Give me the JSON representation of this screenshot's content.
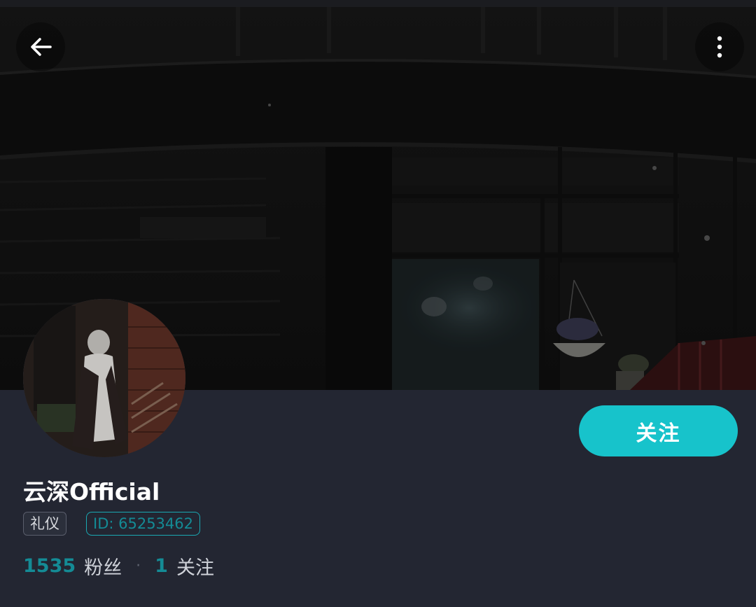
{
  "header": {
    "back_icon": "arrow-left-icon",
    "more_icon": "more-vertical-icon"
  },
  "profile": {
    "name": "云深Official",
    "tag_role": "礼仪",
    "id_label": "ID: 65253462",
    "follow_label": "关注",
    "fans_count": "1535",
    "fans_label": "粉丝",
    "following_count": "1",
    "following_label": "关注",
    "separator": "·"
  },
  "colors": {
    "accent": "#17c3cb",
    "accent_dark": "#148b95",
    "background": "#232632"
  }
}
